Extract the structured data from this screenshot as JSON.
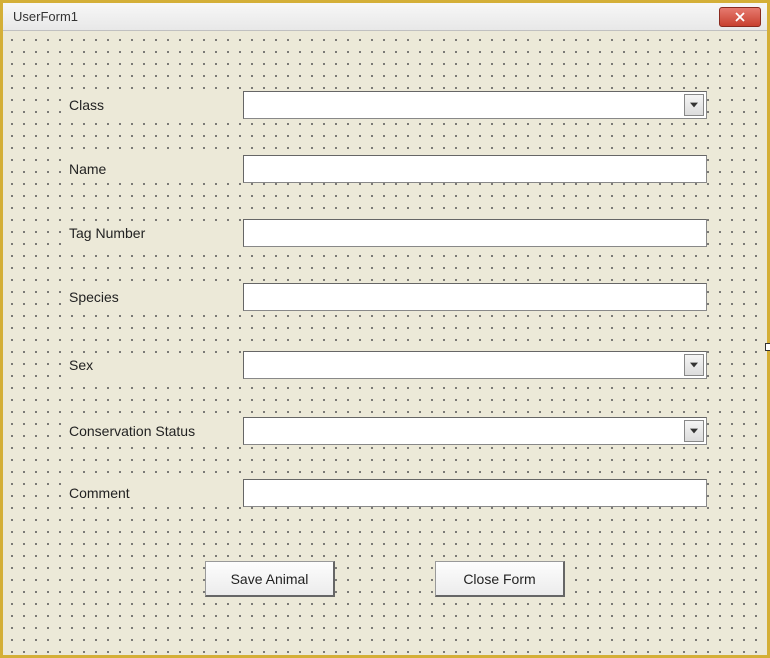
{
  "window": {
    "title": "UserForm1"
  },
  "fields": {
    "class": {
      "label": "Class",
      "value": ""
    },
    "name": {
      "label": "Name",
      "value": ""
    },
    "tagNumber": {
      "label": "Tag Number",
      "value": ""
    },
    "species": {
      "label": "Species",
      "value": ""
    },
    "sex": {
      "label": "Sex",
      "value": ""
    },
    "conservationStatus": {
      "label": "Conservation Status",
      "value": ""
    },
    "comment": {
      "label": "Comment",
      "value": ""
    }
  },
  "buttons": {
    "save": "Save Animal",
    "close": "Close Form"
  }
}
